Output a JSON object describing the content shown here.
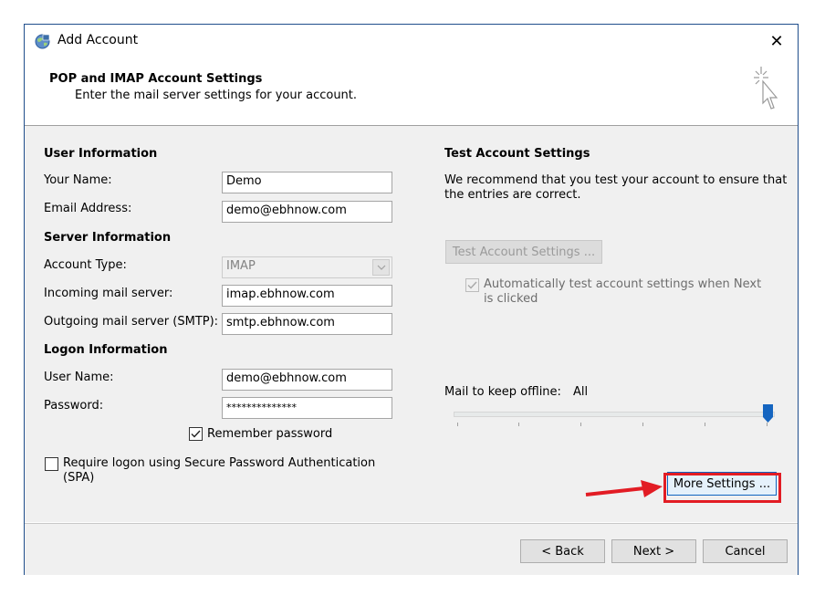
{
  "window": {
    "title": "Add Account",
    "close_glyph": "✕"
  },
  "header": {
    "title": "POP and IMAP Account Settings",
    "subtitle": "Enter the mail server settings for your account."
  },
  "left": {
    "user_info_heading": "User Information",
    "your_name_label": "Your Name:",
    "your_name_value": "Demo",
    "email_label": "Email Address:",
    "email_value": "demo@ebhnow.com",
    "server_info_heading": "Server Information",
    "account_type_label": "Account Type:",
    "account_type_value": "IMAP",
    "incoming_label": "Incoming mail server:",
    "incoming_value": "imap.ebhnow.com",
    "outgoing_label": "Outgoing mail server (SMTP):",
    "outgoing_value": "smtp.ebhnow.com",
    "logon_info_heading": "Logon Information",
    "username_label": "User Name:",
    "username_value": "demo@ebhnow.com",
    "password_label": "Password:",
    "password_value": "**************",
    "remember_label": "Remember password",
    "remember_checked": true,
    "spa_label_line1": "Require logon using Secure Password Authentication",
    "spa_label_line2": "(SPA)",
    "spa_checked": false
  },
  "right": {
    "test_heading": "Test Account Settings",
    "test_desc_line1": "We recommend that you test your account to ensure that",
    "test_desc_line2": "the entries are correct.",
    "test_button": "Test Account Settings ...",
    "auto_test_line1": "Automatically test account settings when Next",
    "auto_test_line2": "is clicked",
    "auto_test_checked": true,
    "offline_label": "Mail to keep offline:",
    "offline_value": "All",
    "offline_slider_fraction": 1.0,
    "more_settings_button": "More Settings ..."
  },
  "footer": {
    "back_button": "< Back",
    "next_button": "Next >",
    "cancel_button": "Cancel"
  },
  "colors": {
    "highlight": "#e21c24",
    "window_border": "#1f4e8c",
    "slider_thumb": "#1565c0"
  }
}
